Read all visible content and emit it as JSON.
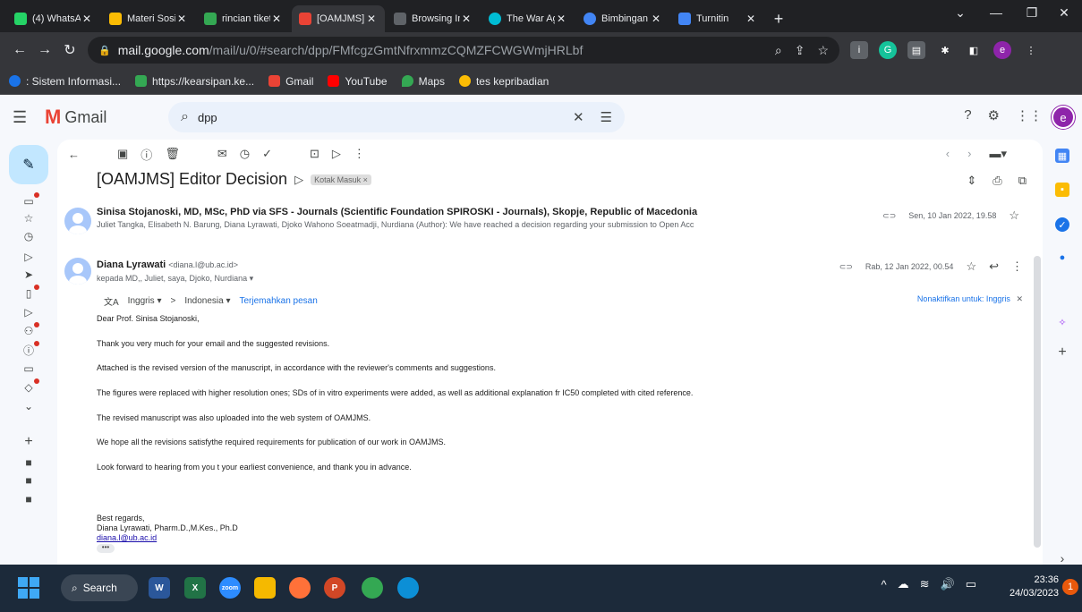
{
  "browser": {
    "tabs": [
      {
        "title": "(4) WhatsAp",
        "color": "#25d366"
      },
      {
        "title": "Materi Sosi",
        "color": "#fbbc04"
      },
      {
        "title": "rincian tiket",
        "color": "#34a853"
      },
      {
        "title": "[OAMJMS]",
        "color": "#ea4335"
      },
      {
        "title": "Browsing In",
        "color": "#5f6368"
      },
      {
        "title": "The War Ag",
        "color": "#00bcd4"
      },
      {
        "title": "Bimbingan",
        "color": "#4285f4"
      },
      {
        "title": "Turnitin",
        "color": "#4285f4"
      }
    ],
    "url_host": "mail.google.com",
    "url_path": "/mail/u/0/#search/dpp/FMfcgzGmtNfrxmmzCQMZFCWGWmjHRLbf",
    "bookmarks": [
      {
        "label": ": Sistem Informasi...",
        "color": "#1a73e8"
      },
      {
        "label": "https://kearsipan.ke...",
        "color": "#34a853"
      },
      {
        "label": "Gmail",
        "color": "#ea4335"
      },
      {
        "label": "YouTube",
        "color": "#ff0000"
      },
      {
        "label": "Maps",
        "color": "#34a853"
      },
      {
        "label": "tes kepribadian",
        "color": "#fbbc04"
      }
    ]
  },
  "gmail": {
    "app_name": "Gmail",
    "search_query": "dpp",
    "avatar_letter": "e",
    "subject": "[OAMJMS] Editor Decision",
    "label": "Kotak Masuk ×",
    "messages": [
      {
        "sender": "Sinisa Stojanoski, MD, MSc, PhD via SFS - Journals (Scientific Foundation SPIROSKI - Journals), Skopje, Republic of Macedonia",
        "snippet": "Juliet Tangka, Elisabeth N. Barung, Diana Lyrawati, Djoko Wahono Soeatmadji, Nurdiana (Author): We have reached a decision regarding your submission to Open Acc",
        "date": "Sen, 10 Jan 2022, 19.58"
      },
      {
        "sender": "Diana Lyrawati",
        "email": "<diana.l@ub.ac.id>",
        "to": "kepada MD,, Juliet, saya, Djoko, Nurdiana ▾",
        "date": "Rab, 12 Jan 2022, 00.54"
      }
    ],
    "translate": {
      "from": "Inggris ▾",
      "to": "Indonesia ▾",
      "link": "Terjemahkan pesan",
      "off": "Nonaktifkan untuk: Inggris"
    },
    "body": [
      "Dear Prof. Sinisa Stojanoski,",
      "Thank you very much for your email and the suggested revisions.",
      "Attached is the revised version of the manuscript, in accordance with the reviewer's comments and suggestions.",
      "The figures were replaced with higher resolution ones; SDs of in vitro experiments were added, as well as additional explanation fr IC50 completed with cited reference.",
      "The revised manuscript was also uploaded into the web system of OAMJMS.",
      "We hope all the revisions satisfythe required requirements for publication of our work in OAMJMS.",
      "Look forward to hearing from you t your earliest convenience, and thank you in advance."
    ],
    "signature": {
      "closing": "Best regards,",
      "name": "Diana Lyrawati, Pharm.D.,M.Kes., Ph.D",
      "email": "diana.l@ub.ac.id"
    }
  },
  "taskbar": {
    "search_label": "Search",
    "time": "23:36",
    "date": "24/03/2023",
    "notifications": "1"
  }
}
